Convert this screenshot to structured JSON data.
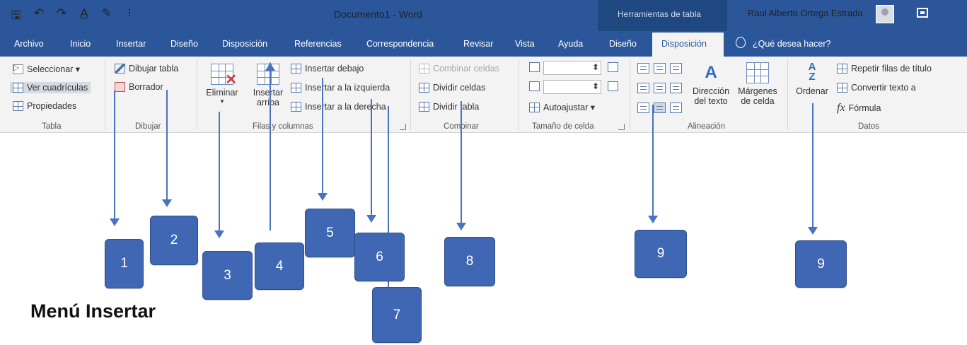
{
  "titlebar": {
    "document_title": "Documento1  -  Word",
    "tools_title": "Herramientas de tabla",
    "user_name": "Raul Alberto Ortega Estrada",
    "qat_icons": [
      "save-icon",
      "undo-icon",
      "redo-icon",
      "font-color-icon",
      "edit-icon",
      "customize-icon"
    ]
  },
  "tabs": [
    {
      "label": "Archivo"
    },
    {
      "label": "Inicio"
    },
    {
      "label": "Insertar"
    },
    {
      "label": "Diseño"
    },
    {
      "label": "Disposición"
    },
    {
      "label": "Referencias"
    },
    {
      "label": "Correspondencia"
    },
    {
      "label": "Revisar"
    },
    {
      "label": "Vista"
    },
    {
      "label": "Ayuda"
    },
    {
      "label": "Diseño"
    },
    {
      "label": "Disposición",
      "active": true
    }
  ],
  "help": {
    "placeholder": "¿Qué desea hacer?"
  },
  "ribbon": {
    "tabla": {
      "label": "Tabla",
      "items": [
        "Seleccionar ▾",
        "Ver cuadrículas",
        "Propiedades"
      ]
    },
    "dibujar": {
      "label": "Dibujar",
      "items": [
        "Dibujar tabla",
        "Borrador"
      ]
    },
    "filas": {
      "label": "Filas y columnas",
      "eliminar": "Eliminar",
      "eliminar_arrow": "▾",
      "insertar_line1": "Insertar",
      "insertar_line2": "arriba",
      "items": [
        "Insertar debajo",
        "Insertar a la izquierda",
        "Insertar a la derecha"
      ]
    },
    "combinar": {
      "label": "Combinar",
      "items": [
        "Combinar celdas",
        "Dividir celdas",
        "Dividir tabla"
      ]
    },
    "tamano": {
      "label": "Tamaño de celda",
      "autoajustar": "Autoajustar ▾"
    },
    "alineacion": {
      "label": "Alineación",
      "direccion_line1": "Dirección",
      "direccion_line2": "del texto",
      "margenes_line1": "Márgenes",
      "margenes_line2": "de celda"
    },
    "datos": {
      "label": "Datos",
      "ordenar": "Ordenar",
      "items": [
        "Repetir filas de título",
        "Convertir texto a",
        "Fórmula"
      ]
    }
  },
  "callouts": [
    "1",
    "2",
    "3",
    "4",
    "5",
    "6",
    "7",
    "8",
    "9",
    "9"
  ],
  "caption": "Menú Insertar",
  "colors": {
    "title_bar": "#2b579a",
    "tools_bar": "#1f4780",
    "ribbon_bg": "#f3f3f3",
    "callout": "#3f67b3"
  }
}
